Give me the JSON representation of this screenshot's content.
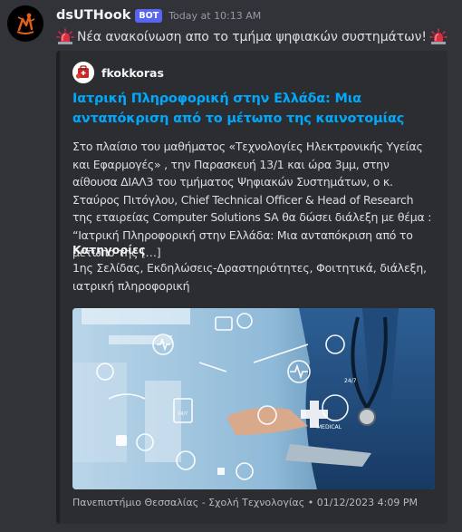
{
  "message": {
    "username": "dsUTHook",
    "bot_tag": "BOT",
    "timestamp": "Today at 10:13 AM",
    "content": "Νέα ανακοίνωση απο το τμήμα ψηφιακών συστημάτων!",
    "content_icon": "rotating-light-emoji"
  },
  "embed": {
    "author": "fkokkoras",
    "title": "Ιατρική Πληροφορική στην Ελλάδα: Μια ανταπόκριση από το μέτωπο της καινοτομίας",
    "description": "Στο πλαίσιο του μαθήματος «Τεχνολογίες Ηλεκτρονικής Υγείας και Εφαρμογές» , την Παρασκευή 13/1 και ώρα 3μμ, στην αίθουσα ΔΙΑΛ3 του τμήματος Ψηφιακών Συστημάτων, ο κ. Σταύρος Πιτόγλου, Chief Technical Officer & Head of Research της εταιρείας Computer Solutions SA θα δώσει διάλεξη με θέμα : “Ιατρική Πληροφορική στην Ελλάδα: Μια ανταπόκριση από το μέτωπο της […]",
    "field_name": "Κατηγορίες",
    "field_value": "1ης Σελίδας, Εκδηλώσεις-Δραστηριότητες, Φοιτητικά, διάλεξη, ιατρική πληροφορική",
    "footer": "Πανεπιστήμιο Θεσσαλίας - Σχολή Τεχνολογίας • 01/12/2023 4:09 PM",
    "image_text": {
      "medical": "MEDICAL",
      "hours": "24/7"
    }
  },
  "colors": {
    "background": "#313338",
    "embed_bg": "#2b2d31",
    "link": "#00a8fc",
    "bot_tag": "#5865f2"
  }
}
